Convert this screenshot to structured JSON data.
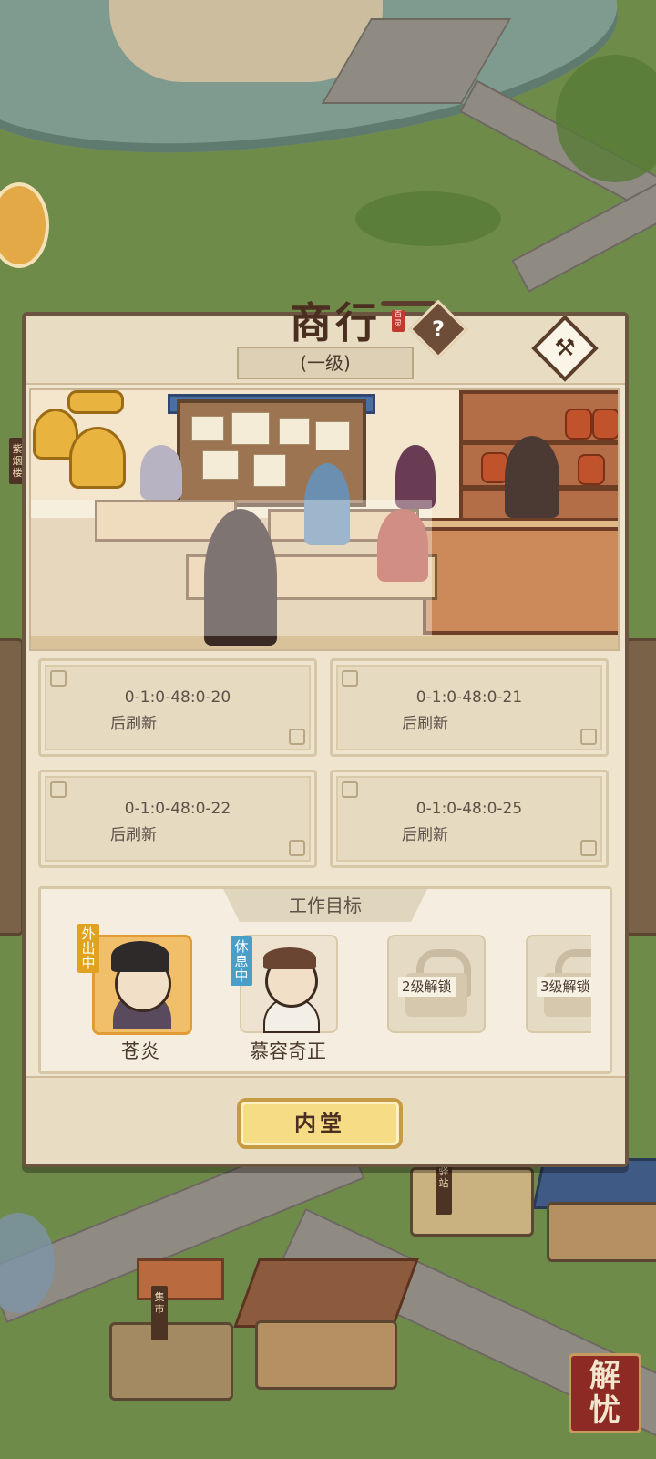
{
  "panel": {
    "title": "商行",
    "seal_text": "百灵",
    "level": "(一级)",
    "help_glyph": "?",
    "upgrade_glyph": "⚒"
  },
  "tasks": [
    {
      "time": "0-1:0-48:0-20",
      "note": "后刷新"
    },
    {
      "time": "0-1:0-48:0-21",
      "note": "后刷新"
    },
    {
      "time": "0-1:0-48:0-22",
      "note": "后刷新"
    },
    {
      "time": "0-1:0-48:0-25",
      "note": "后刷新"
    }
  ],
  "work": {
    "title": "工作目标",
    "workers": [
      {
        "name": "苍炎",
        "status": "外出中"
      },
      {
        "name": "慕容奇正",
        "status": "休息中"
      }
    ],
    "locked": [
      "2级解锁",
      "3级解锁"
    ]
  },
  "inner_hall_button": "内堂",
  "map": {
    "signs": {
      "left": "紫烟楼",
      "station": "驿站",
      "market": "集市"
    },
    "jieyou": [
      "解",
      "忧"
    ]
  }
}
